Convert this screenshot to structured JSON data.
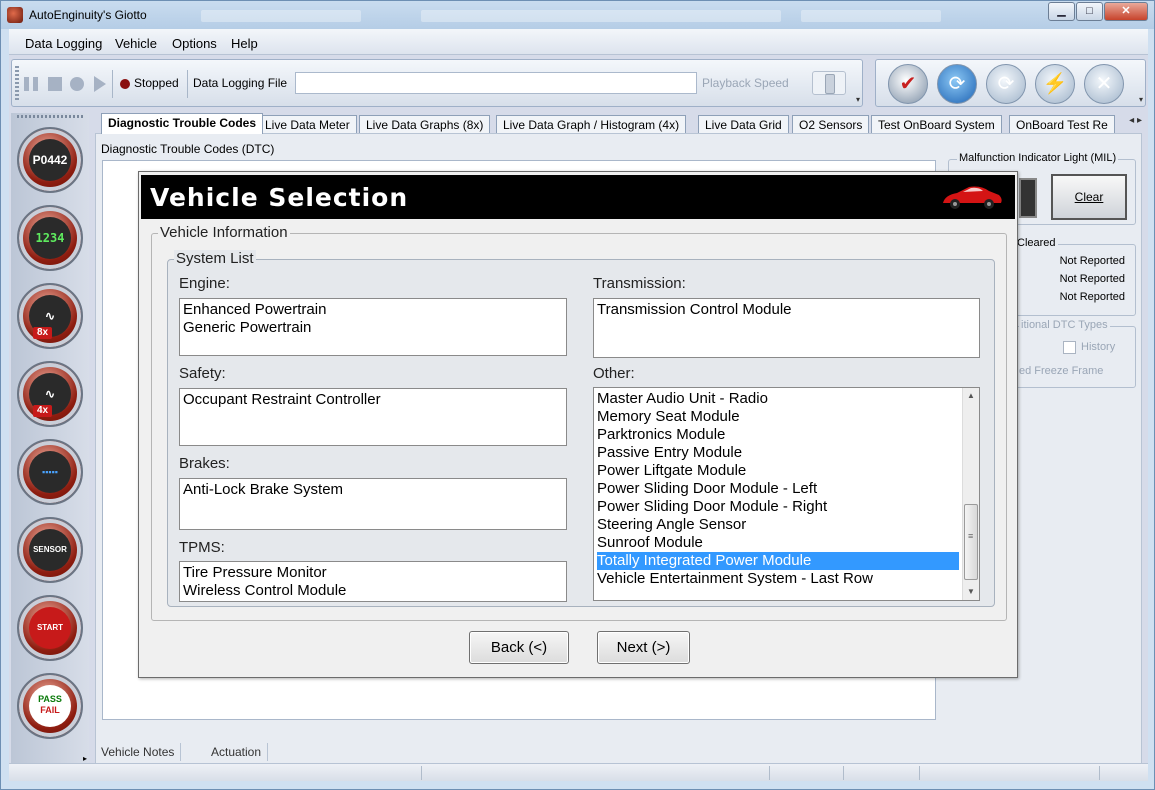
{
  "window": {
    "title": "AutoEnginuity's Giotto",
    "buttons": {
      "minimize": "▁",
      "maximize": "□",
      "close": "✕"
    }
  },
  "menu": [
    "Data Logging",
    "Vehicle",
    "Options",
    "Help"
  ],
  "toolbar": {
    "status": "Stopped",
    "file_label": "Data Logging File",
    "file_value": "",
    "playback_label": "Playback Speed"
  },
  "sidebar": {
    "icons": [
      {
        "icon": "dtc-code-icon",
        "text": "P0442"
      },
      {
        "icon": "lcd-meter-icon",
        "text": "1234"
      },
      {
        "icon": "graph-8x-icon",
        "text": "8x"
      },
      {
        "icon": "graph-4x-icon",
        "text": "4x"
      },
      {
        "icon": "data-grid-icon",
        "text": ""
      },
      {
        "icon": "o2-sensor-icon",
        "text": "SENSOR"
      },
      {
        "icon": "start-button-icon",
        "text": "START"
      },
      {
        "icon": "pass-fail-icon",
        "text": "PASS",
        "text2": "FAIL"
      }
    ]
  },
  "tabs": [
    "Diagnostic Trouble Codes",
    "Live Data Meter",
    "Live Data Graphs (8x)",
    "Live Data Graph / Histogram (4x)",
    "Live Data Grid",
    "O2 Sensors",
    "Test OnBoard System",
    "OnBoard Test Re"
  ],
  "tab_arrows": "◂ ▸",
  "dtc": {
    "label": "Diagnostic Trouble Codes (DTC)",
    "mil_title": "Malfunction Indicator Light (MIL)",
    "clear_label": "Clear",
    "cleared_title": "Cleared",
    "not_reported": [
      "Not Reported",
      "Not Reported",
      "Not Reported"
    ],
    "additional_title": "itional DTC Types",
    "history_label": "History",
    "freeze_frame_label": "ed Freeze Frame"
  },
  "bottom_tabs": [
    "Vehicle Notes",
    "Actuation"
  ],
  "dialog": {
    "title": "Vehicle Selection",
    "vehicle_info_title": "Vehicle Information",
    "system_list_title": "System List",
    "engine_label": "Engine:",
    "engine": [
      "Enhanced Powertrain",
      "Generic Powertrain"
    ],
    "transmission_label": "Transmission:",
    "transmission": [
      "Transmission Control Module"
    ],
    "safety_label": "Safety:",
    "safety": [
      "Occupant Restraint Controller"
    ],
    "brakes_label": "Brakes:",
    "brakes": [
      "Anti-Lock Brake System"
    ],
    "tpms_label": "TPMS:",
    "tpms": [
      "Tire Pressure Monitor",
      "Wireless Control Module"
    ],
    "other_label": "Other:",
    "other": [
      "Master Audio Unit - Radio",
      "Memory Seat Module",
      "Parktronics Module",
      "Passive Entry Module",
      "Power Liftgate Module",
      "Power Sliding Door Module - Left",
      "Power Sliding Door Module - Right",
      "Steering Angle Sensor",
      "Sunroof Module",
      "Totally Integrated Power Module",
      "Vehicle Entertainment System - Last Row"
    ],
    "other_selected": "Totally Integrated Power Module",
    "back_label": "Back (<)",
    "next_label": "Next (>)"
  },
  "colors": {
    "selection": "#3399ff",
    "header": "#000000",
    "accent_red": "#c71a1a"
  }
}
